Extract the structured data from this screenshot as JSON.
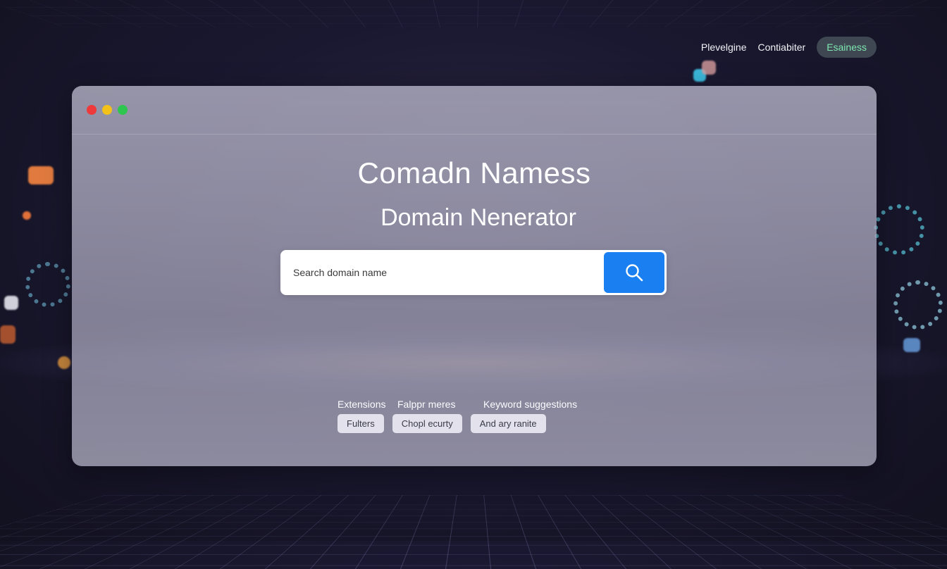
{
  "nav": {
    "links": [
      "Plevelgine",
      "Contiabiter"
    ],
    "pill": "Esainess"
  },
  "window": {
    "title": "Comadn Namess",
    "subtitle": "Domain Nenerator",
    "search": {
      "placeholder": "Search domain name",
      "value": "",
      "button_icon": "search-icon"
    },
    "filter_labels": [
      "Extensions",
      "Falppr meres",
      "Keyword suggestions"
    ],
    "chips": [
      "Fulters",
      "Chopl ecurty",
      "And ary ranite"
    ]
  },
  "colors": {
    "accent": "#1a7ff0",
    "pill_text": "#7ee8b0",
    "traffic_red": "#ee3a3a",
    "traffic_yellow": "#f2c21b",
    "traffic_green": "#2fc64f"
  }
}
